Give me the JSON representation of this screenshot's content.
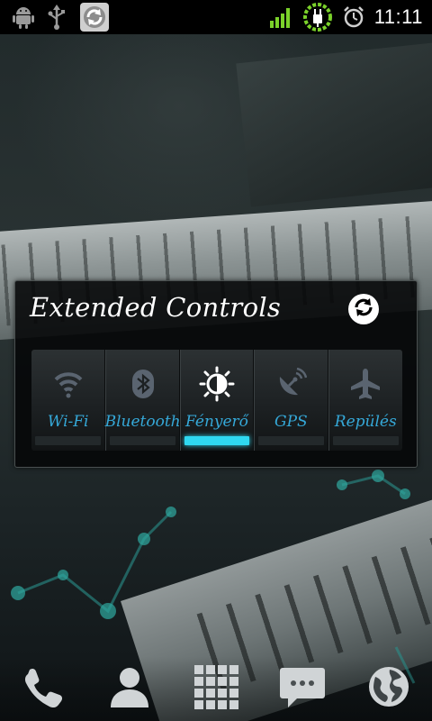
{
  "status_bar": {
    "time": "11:11",
    "left_icons": [
      "android-debug-icon",
      "usb-icon",
      "sync-widget-icon"
    ],
    "right_icons": [
      "signal-icon",
      "battery-charging-icon",
      "alarm-icon"
    ]
  },
  "widget": {
    "title": "Extended Controls",
    "refresh_icon": "refresh-icon",
    "toggles": [
      {
        "label": "Wi-Fi",
        "icon": "wifi-icon",
        "active": false
      },
      {
        "label": "Bluetooth",
        "icon": "bluetooth-icon",
        "active": false
      },
      {
        "label": "Fényerő",
        "icon": "brightness-icon",
        "active": true
      },
      {
        "label": "GPS",
        "icon": "gps-icon",
        "active": false
      },
      {
        "label": "Repülés",
        "icon": "airplane-icon",
        "active": false
      }
    ],
    "colors": {
      "label": "#35a8d8",
      "active_indicator": "#2fd8f0",
      "inactive_icon": "#5a6470"
    }
  },
  "dock": {
    "items": [
      "phone-icon",
      "contacts-icon",
      "app-drawer-icon",
      "messaging-icon",
      "browser-icon"
    ]
  }
}
